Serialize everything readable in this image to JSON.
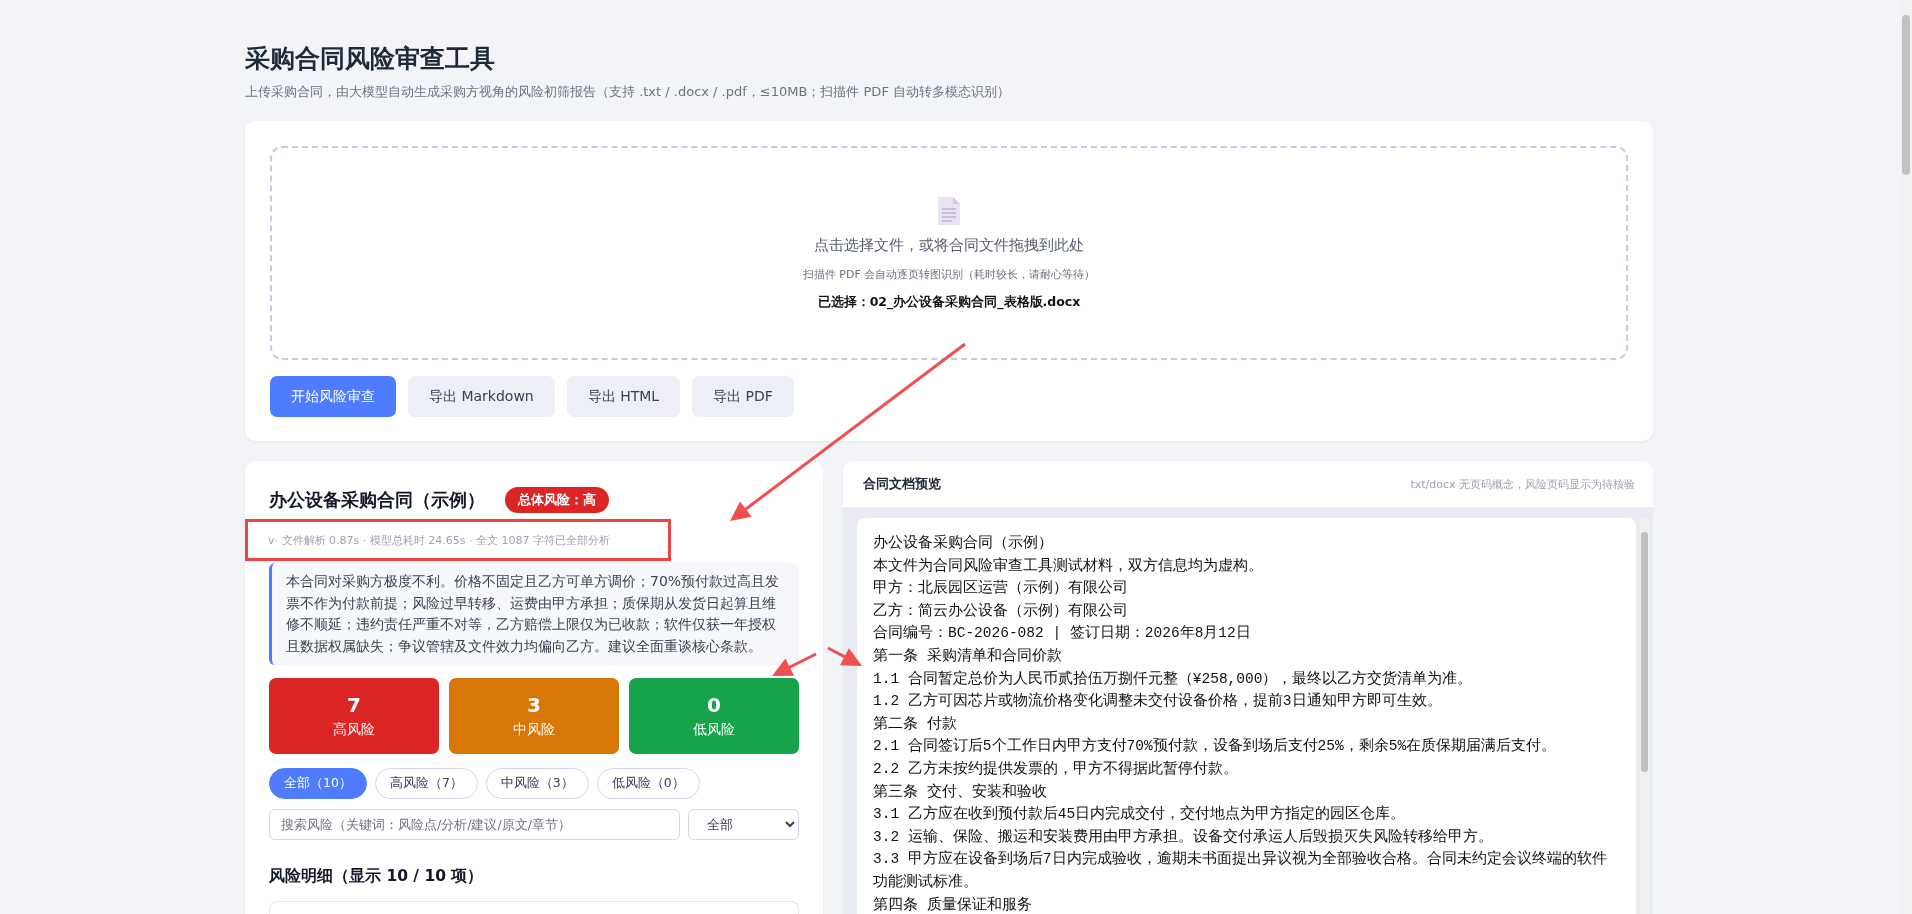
{
  "header": {
    "title": "采购合同风险审查工具",
    "subtitle": "上传采购合同，由大模型自动生成采购方视角的风险初筛报告（支持 .txt / .docx / .pdf，≤10MB；扫描件 PDF 自动转多模态识别）"
  },
  "upload": {
    "prompt": "点击选择文件，或将合同文件拖拽到此处",
    "hint": "扫描件 PDF 会自动逐页转图识别（耗时较长，请耐心等待）",
    "selected_file": "已选择：02_办公设备采购合同_表格版.docx"
  },
  "actions": [
    {
      "label": "开始风险审查",
      "kind": "primary"
    },
    {
      "label": "导出 Markdown",
      "kind": "secondary"
    },
    {
      "label": "导出 HTML",
      "kind": "secondary"
    },
    {
      "label": "导出 PDF",
      "kind": "secondary"
    }
  ],
  "report": {
    "title": "办公设备采购合同（示例）",
    "overall_risk": "总体风险：高",
    "meta": "v· 文件解析 0.87s · 模型总耗时 24.65s · 全文 1087 字符已全部分析",
    "summary": "本合同对采购方极度不利。价格不固定且乙方可单方调价；70%预付款过高且发票不作为付款前提；风险过早转移、运费由甲方承担；质保期从发货日起算且维修不顺延；违约责任严重不对等，乙方赔偿上限仅为已收款；软件仅获一年授权且数据权属缺失；争议管辖及文件效力均偏向乙方。建议全面重谈核心条款。",
    "stats": [
      {
        "count": "7",
        "label": "高风险",
        "color": "#dc2626"
      },
      {
        "count": "3",
        "label": "中风险",
        "color": "#d97706"
      },
      {
        "count": "0",
        "label": "低风险",
        "color": "#16a34a"
      }
    ],
    "filters": [
      {
        "label": "全部（10）",
        "selected": true
      },
      {
        "label": "高风险（7）",
        "selected": false
      },
      {
        "label": "中风险（3）",
        "selected": false
      },
      {
        "label": "低风险（0）",
        "selected": false
      }
    ],
    "search": {
      "placeholder": "搜索风险（关键词：风险点/分析/建议/原文/章节）"
    },
    "select": {
      "value": "全部"
    },
    "details_heading": "风险明细（显示 10 / 10 项）"
  },
  "preview": {
    "title": "合同文档预览",
    "note": "txt/docx 无页码概念，风险页码显示为待核验",
    "lines": [
      "办公设备采购合同（示例）",
      "本文件为合同风险审查工具测试材料，双方信息均为虚构。",
      "甲方：北辰园区运营（示例）有限公司",
      "乙方：简云办公设备（示例）有限公司",
      "合同编号：BC-2026-082 | 签订日期：2026年8月12日",
      "第一条 采购清单和合同价款",
      "1.1 合同暂定总价为人民币贰拾伍万捌仟元整（¥258,000），最终以乙方交货清单为准。",
      "1.2 乙方可因芯片或物流价格变化调整未交付设备价格，提前3日通知甲方即可生效。",
      "第二条 付款",
      "2.1 合同签订后5个工作日内甲方支付70%预付款，设备到场后支付25%，剩余5%在质保期届满后支付。",
      "2.2 乙方未按约提供发票的，甲方不得据此暂停付款。",
      "第三条 交付、安装和验收",
      "3.1 乙方应在收到预付款后45日内完成交付，交付地点为甲方指定的园区仓库。",
      "3.2 运输、保险、搬运和安装费用由甲方承担。设备交付承运人后毁损灭失风险转移给甲方。",
      "3.3 甲方应在设备到场后7日内完成验收，逾期未书面提出异议视为全部验收合格。合同未约定会议终端的软件功能测试标准。",
      "第四条 质量保证和服务"
    ]
  }
}
